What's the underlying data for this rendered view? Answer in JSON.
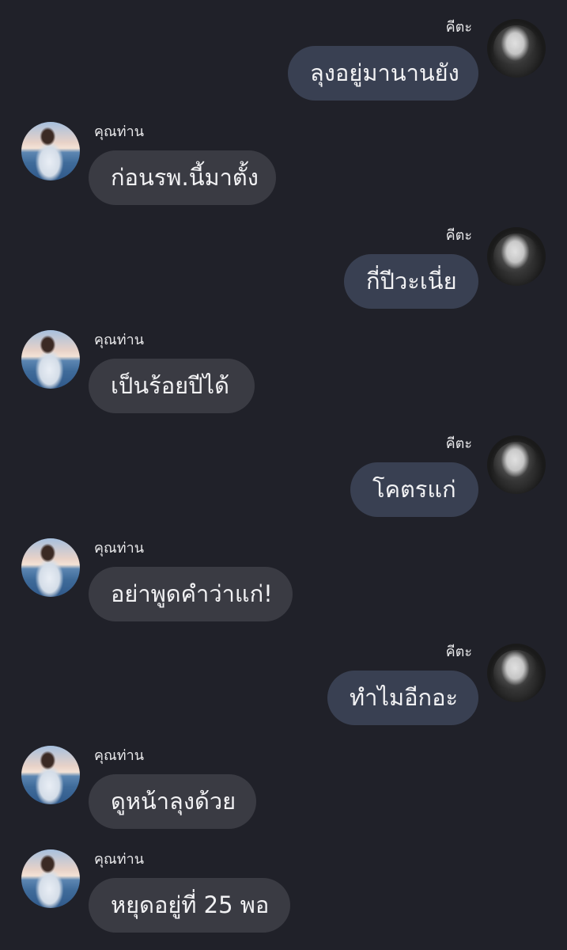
{
  "messages": [
    {
      "side": "me",
      "name": "คีตะ",
      "text": "ลุงอยู่มานานยัง",
      "avatar": "hooded-person-avatar"
    },
    {
      "side": "them",
      "name": "คุณท่าน",
      "text": "ก่อนรพ.นี้มาตั้ง",
      "avatar": "beach-person-avatar"
    },
    {
      "side": "me",
      "name": "คีตะ",
      "text": "กี่ปีวะเนี่ย",
      "avatar": "hooded-person-avatar"
    },
    {
      "side": "them",
      "name": "คุณท่าน",
      "text": "เป็นร้อยปีได้",
      "avatar": "beach-person-avatar"
    },
    {
      "side": "me",
      "name": "คีตะ",
      "text": "โคตรแก่",
      "avatar": "hooded-person-avatar"
    },
    {
      "side": "them",
      "name": "คุณท่าน",
      "text": "อย่าพูดคำว่าแก่!",
      "avatar": "beach-person-avatar"
    },
    {
      "side": "me",
      "name": "คีตะ",
      "text": "ทำไมอีกอะ",
      "avatar": "hooded-person-avatar"
    },
    {
      "side": "them",
      "name": "คุณท่าน",
      "text": "ดูหน้าลุงด้วย",
      "avatar": "beach-person-avatar"
    },
    {
      "side": "them",
      "name": "คุณท่าน",
      "text": "หยุดอยู่ที่ 25 พอ",
      "avatar": "beach-person-avatar"
    }
  ],
  "colors": {
    "background": "#202129",
    "my_bubble": "#394052",
    "their_bubble": "#3a3b43",
    "text": "#f2f2f4"
  }
}
